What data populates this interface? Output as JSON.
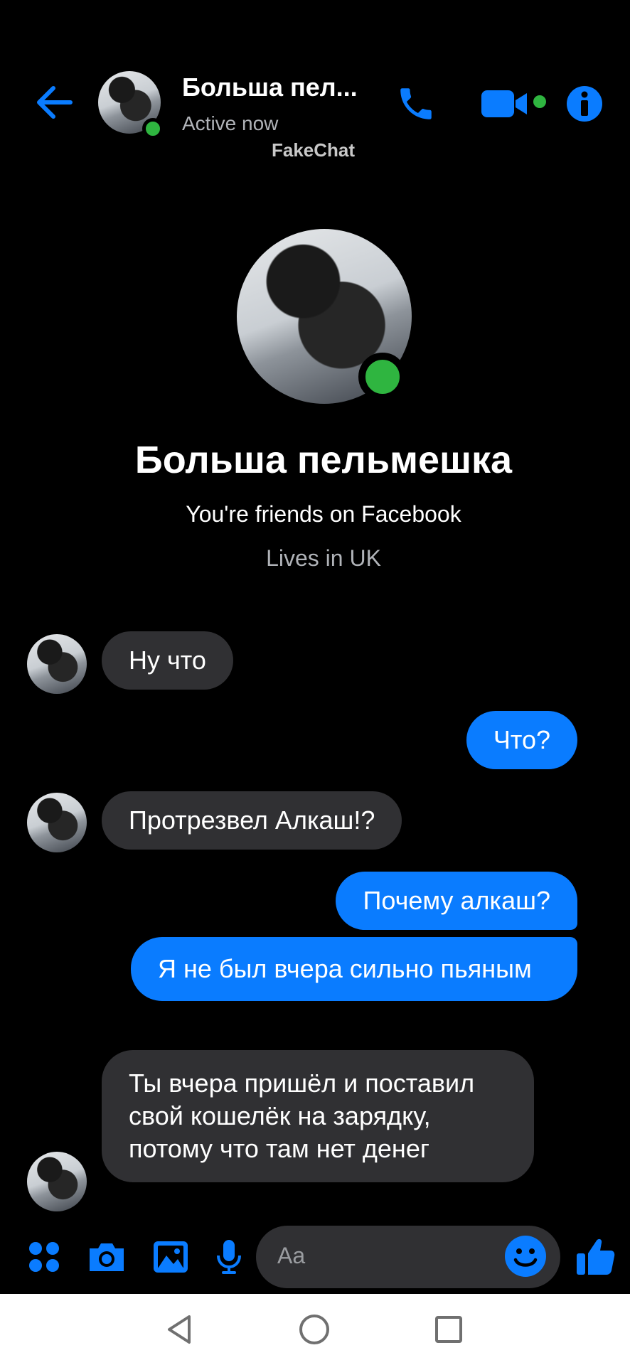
{
  "header": {
    "back_icon": "arrow-left-icon",
    "name": "Больша пел...",
    "status": "Active now",
    "watermark": "FakeChat",
    "call_icon": "phone-icon",
    "video_icon": "video-camera-icon",
    "info_icon": "info-icon"
  },
  "profile": {
    "name": "Больша пельмешка",
    "friends_text": "You're friends on Facebook",
    "lives_text": "Lives in UK"
  },
  "messages": [
    {
      "from": "them",
      "text": "Ну что"
    },
    {
      "from": "me",
      "text": "Что?"
    },
    {
      "from": "them",
      "text": "Протрезвел Алкаш!?"
    },
    {
      "from": "me",
      "text": "Почему алкаш?"
    },
    {
      "from": "me",
      "text": "Я не был вчера сильно пьяным"
    },
    {
      "from": "them",
      "text": "Ты вчера пришёл и поставил свой кошелёк на зарядку, потому что там нет денег"
    }
  ],
  "composer": {
    "placeholder": "Aa",
    "icons": [
      "apps-icon",
      "camera-icon",
      "gallery-icon",
      "microphone-icon",
      "emoji-icon",
      "thumbs-up-icon"
    ]
  },
  "colors": {
    "accent": "#0a7cff",
    "online": "#2fb540",
    "incoming_bubble": "#303033",
    "background": "#000000"
  }
}
